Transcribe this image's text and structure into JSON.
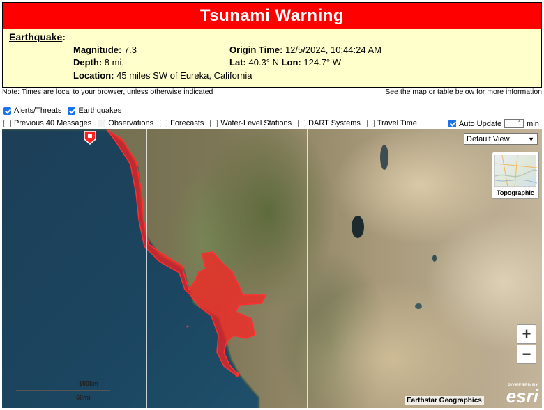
{
  "banner": {
    "title": "Tsunami Warning"
  },
  "earthquake": {
    "heading": "Earthquake",
    "magnitude_label": "Magnitude:",
    "magnitude": "7.3",
    "depth_label": "Depth:",
    "depth": "8 mi.",
    "location_label": "Location:",
    "location": "45 miles SW of Eureka, California",
    "origin_time_label": "Origin Time:",
    "origin_time": "12/5/2024, 10:44:24 AM",
    "lat_label": "Lat:",
    "lat": "40.3° N",
    "lon_label": "Lon:",
    "lon": "124.7° W"
  },
  "notes": {
    "left": "Note: Times are local to your browser, unless otherwise indicated",
    "right": "See the map or table below for more information"
  },
  "layers_row1": [
    {
      "label": "Alerts/Threats",
      "checked": true
    },
    {
      "label": "Earthquakes",
      "checked": true
    }
  ],
  "layers_row2": [
    {
      "label": "Previous 40 Messages",
      "checked": false
    },
    {
      "label": "Observations",
      "checked": false,
      "disabled": true
    },
    {
      "label": "Forecasts",
      "checked": false
    },
    {
      "label": "Water-Level Stations",
      "checked": false
    },
    {
      "label": "DART Systems",
      "checked": false
    },
    {
      "label": "Travel Time",
      "checked": false
    }
  ],
  "auto_update": {
    "label": "Auto Update",
    "checked": true,
    "value": "1",
    "unit": "min"
  },
  "map": {
    "view_select": "Default View",
    "basemap_label": "Topographic",
    "zoom_in": "+",
    "zoom_out": "−",
    "scale_km": "100km",
    "scale_mi": "60mi",
    "attribution": "Earthstar Geographics",
    "esri_powered": "POWERED BY",
    "esri_logo": "esri",
    "threat_color": "#ff2020"
  }
}
